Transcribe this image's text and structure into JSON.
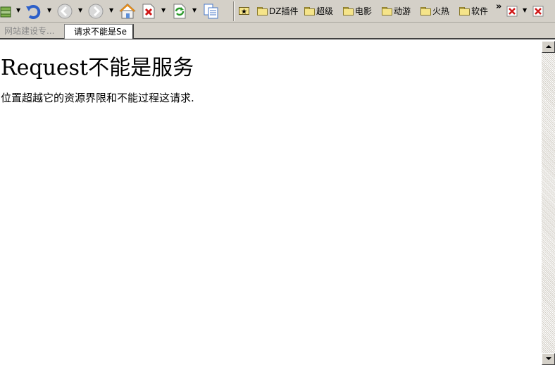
{
  "toolbar": {
    "icons": [
      "cache-icon",
      "undo-icon",
      "back-icon",
      "forward-icon",
      "home-icon",
      "stop-icon",
      "refresh-icon",
      "pages-icon"
    ],
    "favorites": [
      {
        "label": "DZ插件"
      },
      {
        "label": "超级"
      },
      {
        "label": "电影"
      },
      {
        "label": "动游"
      },
      {
        "label": "火热"
      },
      {
        "label": "软件"
      }
    ],
    "more_label": "»"
  },
  "tabs": [
    {
      "label": "网站建设专..."
    },
    {
      "label": "请求不能是Se"
    }
  ],
  "page": {
    "heading": "Request不能是服务",
    "message": "位置超越它的资源界限和不能过程这请求."
  }
}
